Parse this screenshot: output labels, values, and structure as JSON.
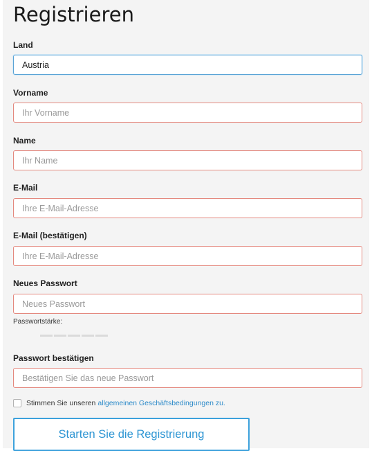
{
  "page": {
    "title": "Registrieren"
  },
  "form": {
    "land": {
      "label": "Land",
      "value": "Austria"
    },
    "vorname": {
      "label": "Vorname",
      "placeholder": "Ihr Vorname"
    },
    "name": {
      "label": "Name",
      "placeholder": "Ihr Name"
    },
    "email": {
      "label": "E-Mail",
      "placeholder": "Ihre E-Mail-Adresse"
    },
    "email_confirm": {
      "label": "E-Mail (bestätigen)",
      "placeholder": "Ihre E-Mail-Adresse"
    },
    "password": {
      "label": "Neues Passwort",
      "placeholder": "Neues Passwort",
      "strength_label": "Passwortstärke:"
    },
    "password_confirm": {
      "label": "Passwort bestätigen",
      "placeholder": "Bestätigen Sie das neue Passwort"
    },
    "terms": {
      "text": "Stimmen Sie unseren",
      "link": "allgemeinen Geschäftsbedingungen zu.",
      "checked": false
    },
    "submit_label": "Starten Sie die Registrierung"
  },
  "colors": {
    "error_border": "#e4897f",
    "focus_border": "#5aa4d6",
    "accent": "#2d95d3",
    "panel_background": "#f4f4f4"
  }
}
